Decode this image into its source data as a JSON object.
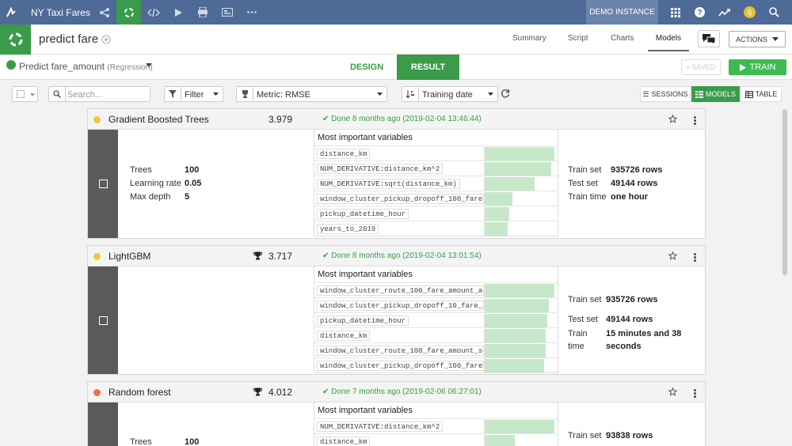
{
  "topbar": {
    "project_name": "NY Taxi Fares",
    "instance_label": "DEMO INSTANCE",
    "user_initial": "S"
  },
  "header": {
    "title": "predict fare",
    "nav": [
      "Summary",
      "Script",
      "Charts",
      "Models"
    ],
    "active_nav": "Models",
    "actions_label": "ACTIONS"
  },
  "subheader": {
    "prediction_label": "Predict fare_amount",
    "prediction_type": "(Regression)",
    "tab_design": "DESIGN",
    "tab_result": "RESULT",
    "saved_label": "SAVED",
    "train_label": "TRAIN"
  },
  "toolbar": {
    "search_placeholder": "Search...",
    "filter_label": "Filter",
    "metric_label": "Metric: RMSE",
    "sort_label": "Training date",
    "view_sessions": "SESSIONS",
    "view_models": "MODELS",
    "view_table": "TABLE"
  },
  "colors": {
    "accent_green": "#3a9c4a",
    "topbar_blue": "#4e6a96",
    "status_yellow": "#f5c342",
    "status_orange": "#e8734f",
    "bar_green": "#c6e8c9"
  },
  "models": [
    {
      "name": "Gradient Boosted Trees",
      "score": "3.979",
      "best": false,
      "status": "Done 8 months ago (2019-02-04 13:46:44)",
      "params": [
        {
          "k": "Trees",
          "v": "100"
        },
        {
          "k": "Learning rate",
          "v": "0.05"
        },
        {
          "k": "Max depth",
          "v": "5"
        }
      ],
      "vars_title": "Most important variables",
      "variables": [
        {
          "name": "distance_km",
          "importance": 1.0
        },
        {
          "name": "NUM_DERIVATIVE:distance_km^2",
          "importance": 0.95
        },
        {
          "name": "NUM_DERIVATIVE:sqrt(distance_km)",
          "importance": 0.72
        },
        {
          "name": "window_cluster_pickup_dropoff_100_fare...",
          "importance": 0.4
        },
        {
          "name": "pickup_datetime_hour",
          "importance": 0.35
        },
        {
          "name": "years_to_2019",
          "importance": 0.33
        }
      ],
      "stats": [
        {
          "k": "Train set",
          "v": "935726 rows"
        },
        {
          "k": "Test set",
          "v": "49144 rows"
        },
        {
          "k": "Train time",
          "v": "one hour"
        }
      ]
    },
    {
      "name": "LightGBM",
      "score": "3.717",
      "best": true,
      "status": "Done 8 months ago (2019-02-04 13:01:54)",
      "params": [],
      "vars_title": "Most important variables",
      "variables": [
        {
          "name": "window_cluster_route_100_fare_amount_a...",
          "importance": 1.0
        },
        {
          "name": "window_cluster_pickup_dropoff_10_fare_...",
          "importance": 0.92
        },
        {
          "name": "pickup_datetime_hour",
          "importance": 0.9
        },
        {
          "name": "distance_km",
          "importance": 0.88
        },
        {
          "name": "window_cluster_route_100_fare_amount_s...",
          "importance": 0.87
        },
        {
          "name": "window_cluster_pickup_dropoff_100_fare...",
          "importance": 0.85
        }
      ],
      "stats": [
        {
          "k": "Train set",
          "v": "935726 rows"
        },
        {
          "k": "Test set",
          "v": "49144 rows"
        },
        {
          "k": "Train time",
          "v": "15 minutes and 38 seconds"
        }
      ]
    },
    {
      "name": "Random forest",
      "score": "4.012",
      "best": true,
      "status": "Done 7 months ago (2019-02-06 06:27:01)",
      "params": [
        {
          "k": "Trees",
          "v": "100"
        }
      ],
      "vars_title": "Most important variables",
      "variables": [
        {
          "name": "NUM_DERIVATIVE:distance_km^2",
          "importance": 1.0
        },
        {
          "name": "distance_km",
          "importance": 0.43
        }
      ],
      "stats": [
        {
          "k": "Train set",
          "v": "93838 rows"
        }
      ]
    }
  ]
}
